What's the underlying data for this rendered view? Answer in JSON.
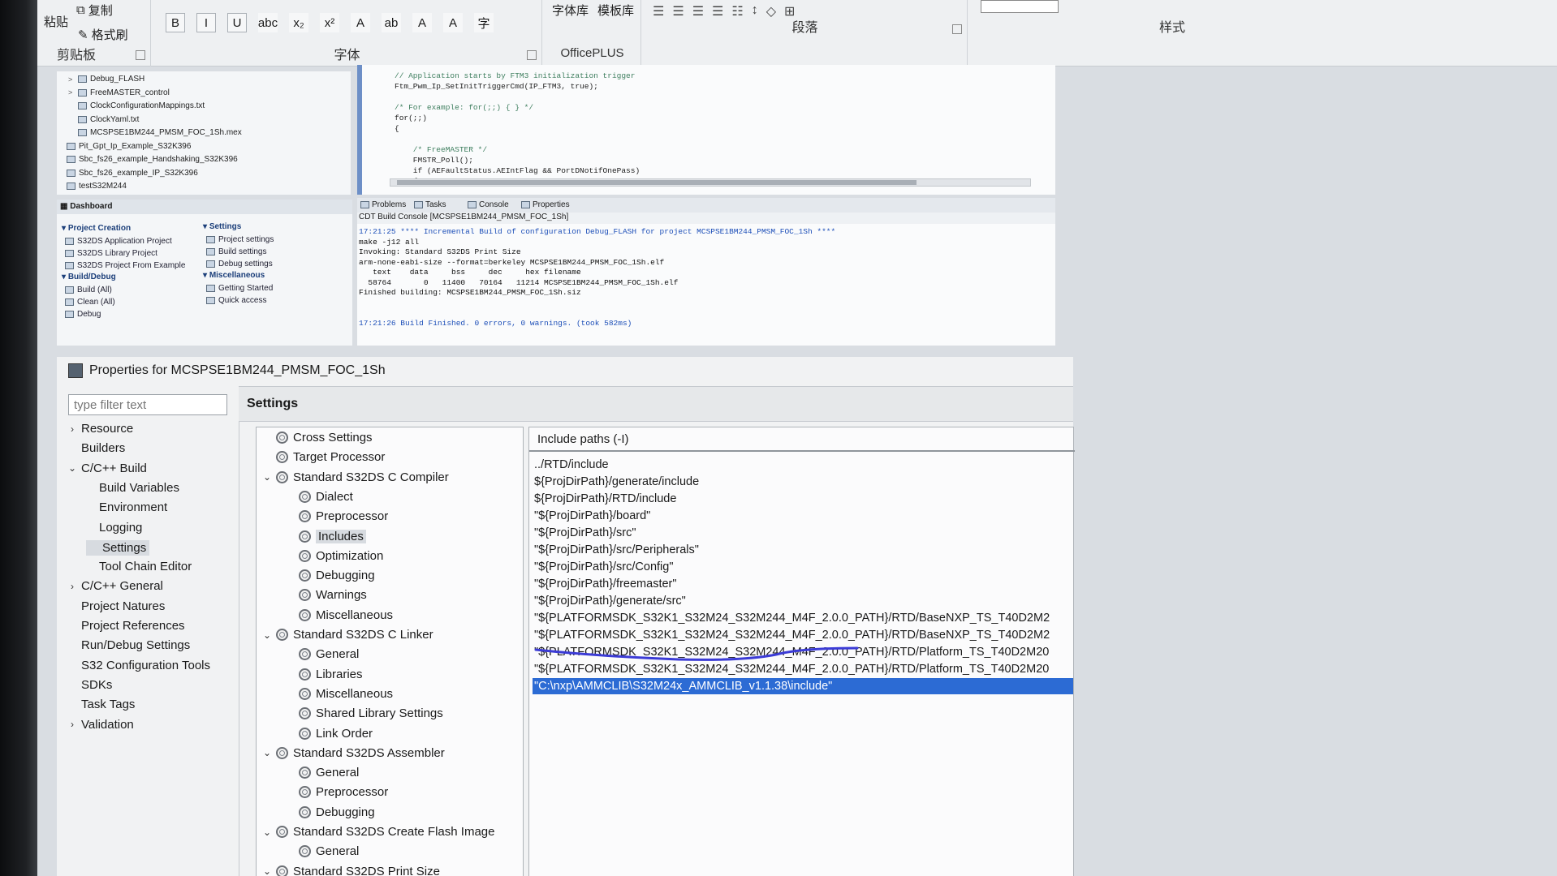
{
  "ribbon": {
    "clipboard": {
      "paste": "粘贴",
      "copy": "复制",
      "format_painter": "格式刷",
      "label": "剪贴板"
    },
    "font": {
      "label": "字体",
      "buttons": [
        "B",
        "I",
        "U",
        "abc",
        "x₂",
        "x²",
        "A",
        "ab",
        "A",
        "A",
        "字"
      ]
    },
    "templates": {
      "font_lib": "字体库",
      "template_lib": "模板库",
      "officeplus": "OfficePLUS"
    },
    "paragraph": {
      "label": "段落"
    },
    "styles": {
      "label": "样式"
    }
  },
  "project_tree": [
    {
      "label": "Debug_FLASH",
      "indent": 1,
      "expander": ">"
    },
    {
      "label": "FreeMASTER_control",
      "indent": 1,
      "expander": ">"
    },
    {
      "label": "ClockConfigurationMappings.txt",
      "indent": 1,
      "expander": ""
    },
    {
      "label": "ClockYaml.txt",
      "indent": 1,
      "expander": ""
    },
    {
      "label": "MCSPSE1BM244_PMSM_FOC_1Sh.mex",
      "indent": 1,
      "expander": ""
    },
    {
      "label": "Pit_Gpt_Ip_Example_S32K396",
      "indent": 0,
      "expander": ""
    },
    {
      "label": "Sbc_fs26_example_Handshaking_S32K396",
      "indent": 0,
      "expander": ""
    },
    {
      "label": "Sbc_fs26_example_IP_S32K396",
      "indent": 0,
      "expander": ""
    },
    {
      "label": "testS32M244",
      "indent": 0,
      "expander": ""
    }
  ],
  "editor": {
    "lines": [
      {
        "text": "// Application starts by FTM3 initialization trigger",
        "kind": "comment"
      },
      {
        "text": "Ftm_Pwm_Ip_SetInitTriggerCmd(IP_FTM3, true);",
        "kind": "code"
      },
      {
        "text": "",
        "kind": "code"
      },
      {
        "text": "/* For example: for(;;) { } */",
        "kind": "comment"
      },
      {
        "text": "for(;;)",
        "kind": "code"
      },
      {
        "text": "{",
        "kind": "code"
      },
      {
        "text": "",
        "kind": "code"
      },
      {
        "text": "    /* FreeMASTER */",
        "kind": "comment"
      },
      {
        "text": "    FMSTR_Poll();",
        "kind": "code"
      },
      {
        "text": "    if (AEFaultStatus.AEIntFlag && PortDNotifOnePass)",
        "kind": "code"
      },
      {
        "text": "    {",
        "kind": "code"
      }
    ]
  },
  "dashboard": {
    "tab": "Dashboard",
    "project_creation": {
      "title": "Project Creation",
      "items": [
        "S32DS Application Project",
        "S32DS Library Project",
        "S32DS Project From Example"
      ]
    },
    "build_debug": {
      "title": "Build/Debug",
      "items": [
        "Build  (All)",
        "Clean  (All)",
        "Debug"
      ]
    },
    "settings": {
      "title": "Settings",
      "items": [
        "Project settings",
        "Build settings",
        "Debug settings"
      ]
    },
    "misc": {
      "title": "Miscellaneous",
      "items": [
        "Getting Started",
        "Quick access"
      ]
    }
  },
  "console": {
    "tabs": [
      "Problems",
      "Tasks",
      "Console",
      "Properties"
    ],
    "title": "CDT Build Console [MCSPSE1BM244_PMSM_FOC_1Sh]",
    "lines": [
      {
        "text": "17:21:25 **** Incremental Build of configuration Debug_FLASH for project MCSPSE1BM244_PMSM_FOC_1Sh ****",
        "kind": "blue"
      },
      {
        "text": "make -j12 all",
        "kind": "plain"
      },
      {
        "text": "Invoking: Standard S32DS Print Size",
        "kind": "plain"
      },
      {
        "text": "arm-none-eabi-size --format=berkeley MCSPSE1BM244_PMSM_FOC_1Sh.elf",
        "kind": "plain"
      },
      {
        "text": "   text    data     bss     dec     hex filename",
        "kind": "plain"
      },
      {
        "text": "  58764       0   11400   70164   11214 MCSPSE1BM244_PMSM_FOC_1Sh.elf",
        "kind": "plain"
      },
      {
        "text": "Finished building: MCSPSE1BM244_PMSM_FOC_1Sh.siz",
        "kind": "plain"
      },
      {
        "text": "",
        "kind": "plain"
      },
      {
        "text": "",
        "kind": "plain"
      },
      {
        "text": "17:21:26 Build Finished. 0 errors, 0 warnings. (took 582ms)",
        "kind": "blue"
      }
    ]
  },
  "dialog": {
    "title": "Properties for MCSPSE1BM244_PMSM_FOC_1Sh",
    "filter_placeholder": "type filter text",
    "settings_header": "Settings",
    "nav": [
      {
        "label": "Resource",
        "level": 0,
        "expander": "›",
        "selected": false
      },
      {
        "label": "Builders",
        "level": 0,
        "expander": "",
        "selected": false
      },
      {
        "label": "C/C++ Build",
        "level": 0,
        "expander": "⌄",
        "selected": false
      },
      {
        "label": "Build Variables",
        "level": 1,
        "expander": "",
        "selected": false
      },
      {
        "label": "Environment",
        "level": 1,
        "expander": "",
        "selected": false
      },
      {
        "label": "Logging",
        "level": 1,
        "expander": "",
        "selected": false
      },
      {
        "label": "Settings",
        "level": 1,
        "expander": "",
        "selected": true
      },
      {
        "label": "Tool Chain Editor",
        "level": 1,
        "expander": "",
        "selected": false
      },
      {
        "label": "C/C++ General",
        "level": 0,
        "expander": "›",
        "selected": false
      },
      {
        "label": "Project Natures",
        "level": 0,
        "expander": "",
        "selected": false
      },
      {
        "label": "Project References",
        "level": 0,
        "expander": "",
        "selected": false
      },
      {
        "label": "Run/Debug Settings",
        "level": 0,
        "expander": "",
        "selected": false
      },
      {
        "label": "S32 Configuration Tools",
        "level": 0,
        "expander": "",
        "selected": false
      },
      {
        "label": "SDKs",
        "level": 0,
        "expander": "",
        "selected": false
      },
      {
        "label": "Task Tags",
        "level": 0,
        "expander": "",
        "selected": false
      },
      {
        "label": "Validation",
        "level": 0,
        "expander": "›",
        "selected": false
      }
    ],
    "tool_tree": [
      {
        "label": "Cross Settings",
        "level": 0,
        "expander": "",
        "selected": false
      },
      {
        "label": "Target Processor",
        "level": 0,
        "expander": "",
        "selected": false
      },
      {
        "label": "Standard S32DS C Compiler",
        "level": 0,
        "expander": "⌄",
        "selected": false
      },
      {
        "label": "Dialect",
        "level": 1,
        "expander": "",
        "selected": false
      },
      {
        "label": "Preprocessor",
        "level": 1,
        "expander": "",
        "selected": false
      },
      {
        "label": "Includes",
        "level": 1,
        "expander": "",
        "selected": true
      },
      {
        "label": "Optimization",
        "level": 1,
        "expander": "",
        "selected": false
      },
      {
        "label": "Debugging",
        "level": 1,
        "expander": "",
        "selected": false
      },
      {
        "label": "Warnings",
        "level": 1,
        "expander": "",
        "selected": false
      },
      {
        "label": "Miscellaneous",
        "level": 1,
        "expander": "",
        "selected": false
      },
      {
        "label": "Standard S32DS C Linker",
        "level": 0,
        "expander": "⌄",
        "selected": false
      },
      {
        "label": "General",
        "level": 1,
        "expander": "",
        "selected": false
      },
      {
        "label": "Libraries",
        "level": 1,
        "expander": "",
        "selected": false
      },
      {
        "label": "Miscellaneous",
        "level": 1,
        "expander": "",
        "selected": false
      },
      {
        "label": "Shared Library Settings",
        "level": 1,
        "expander": "",
        "selected": false
      },
      {
        "label": "Link Order",
        "level": 1,
        "expander": "",
        "selected": false
      },
      {
        "label": "Standard S32DS Assembler",
        "level": 0,
        "expander": "⌄",
        "selected": false
      },
      {
        "label": "General",
        "level": 1,
        "expander": "",
        "selected": false
      },
      {
        "label": "Preprocessor",
        "level": 1,
        "expander": "",
        "selected": false
      },
      {
        "label": "Debugging",
        "level": 1,
        "expander": "",
        "selected": false
      },
      {
        "label": "Standard S32DS Create Flash Image",
        "level": 0,
        "expander": "⌄",
        "selected": false
      },
      {
        "label": "General",
        "level": 1,
        "expander": "",
        "selected": false
      },
      {
        "label": "Standard S32DS Print Size",
        "level": 0,
        "expander": "⌄",
        "selected": false
      }
    ],
    "include_paths": {
      "header": "Include paths (-I)",
      "items": [
        {
          "text": "../RTD/include",
          "selected": false
        },
        {
          "text": "${ProjDirPath}/generate/include",
          "selected": false
        },
        {
          "text": "${ProjDirPath}/RTD/include",
          "selected": false
        },
        {
          "text": "\"${ProjDirPath}/board\"",
          "selected": false
        },
        {
          "text": "\"${ProjDirPath}/src\"",
          "selected": false
        },
        {
          "text": "\"${ProjDirPath}/src/Peripherals\"",
          "selected": false
        },
        {
          "text": "\"${ProjDirPath}/src/Config\"",
          "selected": false
        },
        {
          "text": "\"${ProjDirPath}/freemaster\"",
          "selected": false
        },
        {
          "text": "\"${ProjDirPath}/generate/src\"",
          "selected": false
        },
        {
          "text": "\"${PLATFORMSDK_S32K1_S32M24_S32M244_M4F_2.0.0_PATH}/RTD/BaseNXP_TS_T40D2M2",
          "selected": false
        },
        {
          "text": "\"${PLATFORMSDK_S32K1_S32M24_S32M244_M4F_2.0.0_PATH}/RTD/BaseNXP_TS_T40D2M2",
          "selected": false
        },
        {
          "text": "\"${PLATFORMSDK_S32K1_S32M24_S32M244_M4F_2.0.0_PATH}/RTD/Platform_TS_T40D2M20",
          "selected": false
        },
        {
          "text": "\"${PLATFORMSDK_S32K1_S32M24_S32M244_M4F_2.0.0_PATH}/RTD/Platform_TS_T40D2M20",
          "selected": false
        },
        {
          "text": "\"C:\\nxp\\AMMCLIB\\S32M24x_AMMCLIB_v1.1.38\\include\"",
          "selected": true
        }
      ]
    }
  },
  "colors": {
    "selection": "#2c6bd4",
    "pen_annotation": "#3b3bd6",
    "console_blue": "#1d4fb8"
  }
}
